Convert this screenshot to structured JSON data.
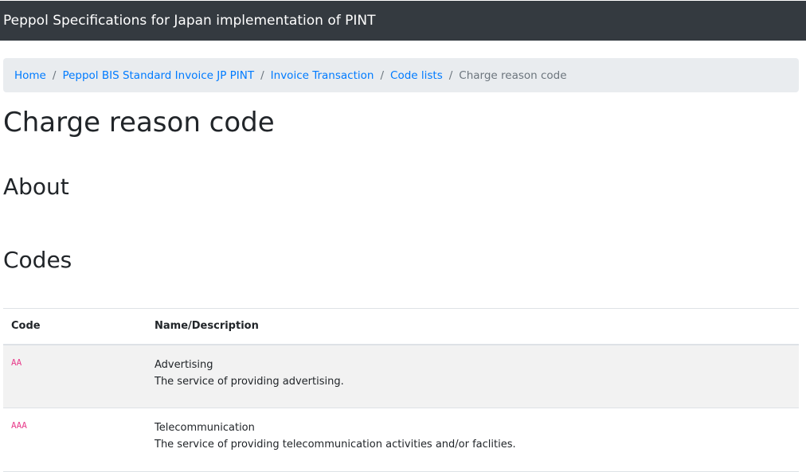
{
  "navbar": {
    "brand": "Peppol Specifications for Japan implementation of PINT"
  },
  "breadcrumb": {
    "items": [
      "Home",
      "Peppol BIS Standard Invoice JP PINT",
      "Invoice Transaction",
      "Code lists"
    ],
    "active": "Charge reason code",
    "separator": "/"
  },
  "page": {
    "title": "Charge reason code",
    "about_heading": "About",
    "codes_heading": "Codes"
  },
  "table": {
    "headers": {
      "code": "Code",
      "name": "Name/Description"
    },
    "rows": [
      {
        "code": "AA",
        "name": "Advertising",
        "description": "The service of providing advertising."
      },
      {
        "code": "AAA",
        "name": "Telecommunication",
        "description": "The service of providing telecommunication activities and/or faclities."
      }
    ]
  }
}
